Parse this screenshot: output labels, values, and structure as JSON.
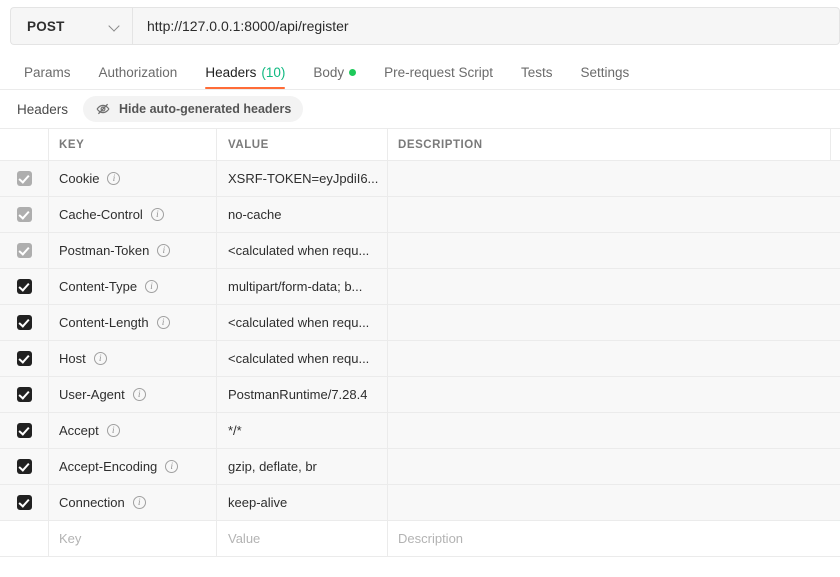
{
  "request": {
    "method": "POST",
    "method_chevron_icon": "chevron-down-icon",
    "url": "http://127.0.0.1:8000/api/register"
  },
  "tabs": [
    {
      "label": "Params",
      "active": false
    },
    {
      "label": "Authorization",
      "active": false
    },
    {
      "label": "Headers",
      "active": true,
      "count": "(10)"
    },
    {
      "label": "Body",
      "active": false,
      "dot": true
    },
    {
      "label": "Pre-request Script",
      "active": false
    },
    {
      "label": "Tests",
      "active": false
    },
    {
      "label": "Settings",
      "active": false
    }
  ],
  "subheader": {
    "title": "Headers",
    "toggle_label": "Hide auto-generated headers",
    "toggle_icon": "eye-off-icon"
  },
  "table": {
    "columns": [
      "KEY",
      "VALUE",
      "DESCRIPTION"
    ],
    "rows": [
      {
        "checked": true,
        "checkbox_style": "gray",
        "key": "Cookie",
        "value": "XSRF-TOKEN=eyJpdiI6...",
        "description": ""
      },
      {
        "checked": true,
        "checkbox_style": "gray",
        "key": "Cache-Control",
        "value": "no-cache",
        "description": ""
      },
      {
        "checked": true,
        "checkbox_style": "gray",
        "key": "Postman-Token",
        "value": "<calculated when requ...",
        "description": ""
      },
      {
        "checked": true,
        "checkbox_style": "dark",
        "key": "Content-Type",
        "value": "multipart/form-data; b...",
        "description": ""
      },
      {
        "checked": true,
        "checkbox_style": "dark",
        "key": "Content-Length",
        "value": "<calculated when requ...",
        "description": ""
      },
      {
        "checked": true,
        "checkbox_style": "dark",
        "key": "Host",
        "value": "<calculated when requ...",
        "description": ""
      },
      {
        "checked": true,
        "checkbox_style": "dark",
        "key": "User-Agent",
        "value": "PostmanRuntime/7.28.4",
        "description": ""
      },
      {
        "checked": true,
        "checkbox_style": "dark",
        "key": "Accept",
        "value": "*/*",
        "description": ""
      },
      {
        "checked": true,
        "checkbox_style": "dark",
        "key": "Accept-Encoding",
        "value": "gzip, deflate, br",
        "description": ""
      },
      {
        "checked": true,
        "checkbox_style": "dark",
        "key": "Connection",
        "value": "keep-alive",
        "description": ""
      }
    ],
    "placeholder_row": {
      "key": "Key",
      "value": "Value",
      "description": "Description"
    }
  },
  "colors": {
    "accent_orange": "#ff6c37",
    "count_green": "#10b981",
    "dot_green": "#1ec95a",
    "row_bg": "#f8f8f8",
    "border": "#ebebeb"
  }
}
